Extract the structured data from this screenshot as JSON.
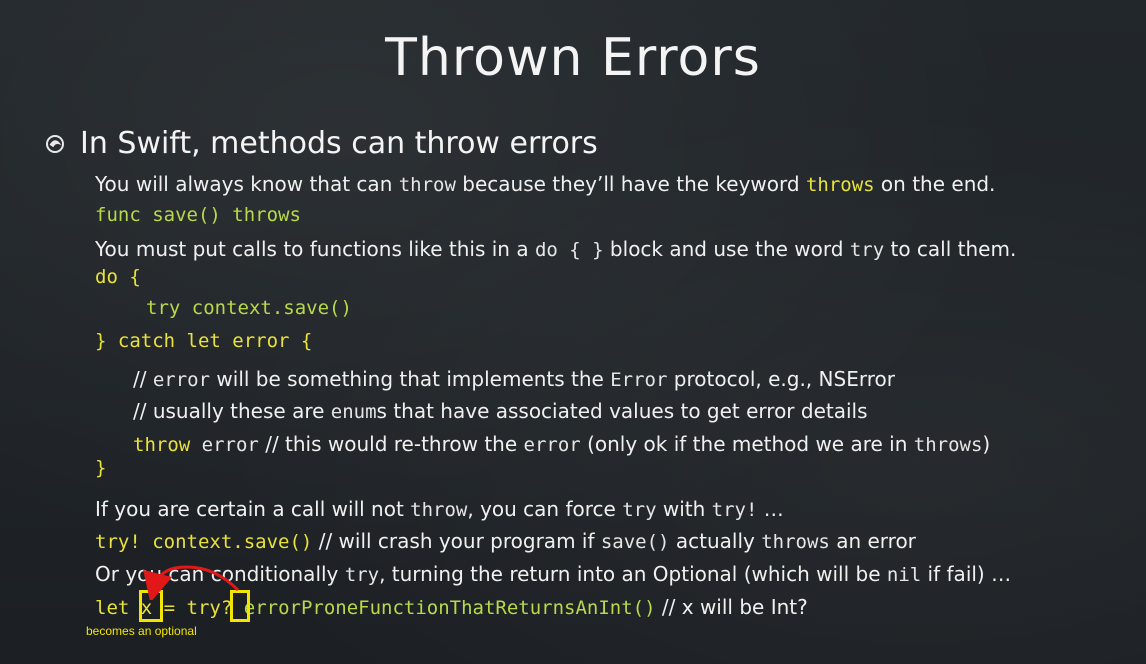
{
  "title": "Thrown Errors",
  "bullet": "In Swift, methods can throw errors",
  "lines": {
    "l1_a": "You will always know that can ",
    "l1_b": "throw",
    "l1_c": " because they’ll have the keyword ",
    "l1_d": "throws",
    "l1_e": " on the end.",
    "l2": "func save() throws",
    "l3_a": "You must put calls to functions like this in a ",
    "l3_b": "do { }",
    "l3_c": " block and use the word ",
    "l3_d": "try",
    "l3_e": " to call them.",
    "l4": "do {",
    "l5": "try context.save()",
    "l6": "} catch let error {",
    "l7_a": "// ",
    "l7_b": "error",
    "l7_c": " will be something that implements the ",
    "l7_d": "Error",
    "l7_e": " protocol, e.g., ",
    "l7_f": "NSError",
    "l8_a": "// usually these are ",
    "l8_b": "enum",
    "l8_c": "s that have associated values to get error details",
    "l9_a": "throw",
    "l9_b": " error",
    "l9_c": " // this would re-throw the ",
    "l9_d": "error",
    "l9_e": " (only ok if the method we are in ",
    "l9_f": "throws",
    "l9_g": ")",
    "l10": "}",
    "l11_a": "If you are certain a call will not ",
    "l11_b": "throw",
    "l11_c": ", you can force ",
    "l11_d": "try",
    "l11_e": " with ",
    "l11_f": "try!",
    "l11_g": " …",
    "l12_a": "try! context.save()",
    "l12_b": " // will crash your program if ",
    "l12_c": "save()",
    "l12_d": " actually ",
    "l12_e": "throws",
    "l12_f": " an error",
    "l13_a": "Or you can conditionally ",
    "l13_b": "try",
    "l13_c": ", turning the return into an Optional (which will be ",
    "l13_d": "nil",
    "l13_e": " if fail) …",
    "l14_a": "let ",
    "l14_b": "x",
    "l14_c": " = ",
    "l14_d": "try?",
    "l14_e": " errorProneFunctionThatReturnsAnInt()",
    "l14_f": " // x will be Int?"
  },
  "annotation": "becomes an optional",
  "colors": {
    "background": "#1f2327",
    "code_yellow": "#e8e23a",
    "code_green": "#b8d94a",
    "highlight_box": "#f2e600",
    "arrow_red": "#e01818"
  },
  "icons": {
    "bullet": "swirl-bullet-icon",
    "arrow": "curved-arrow-icon"
  }
}
